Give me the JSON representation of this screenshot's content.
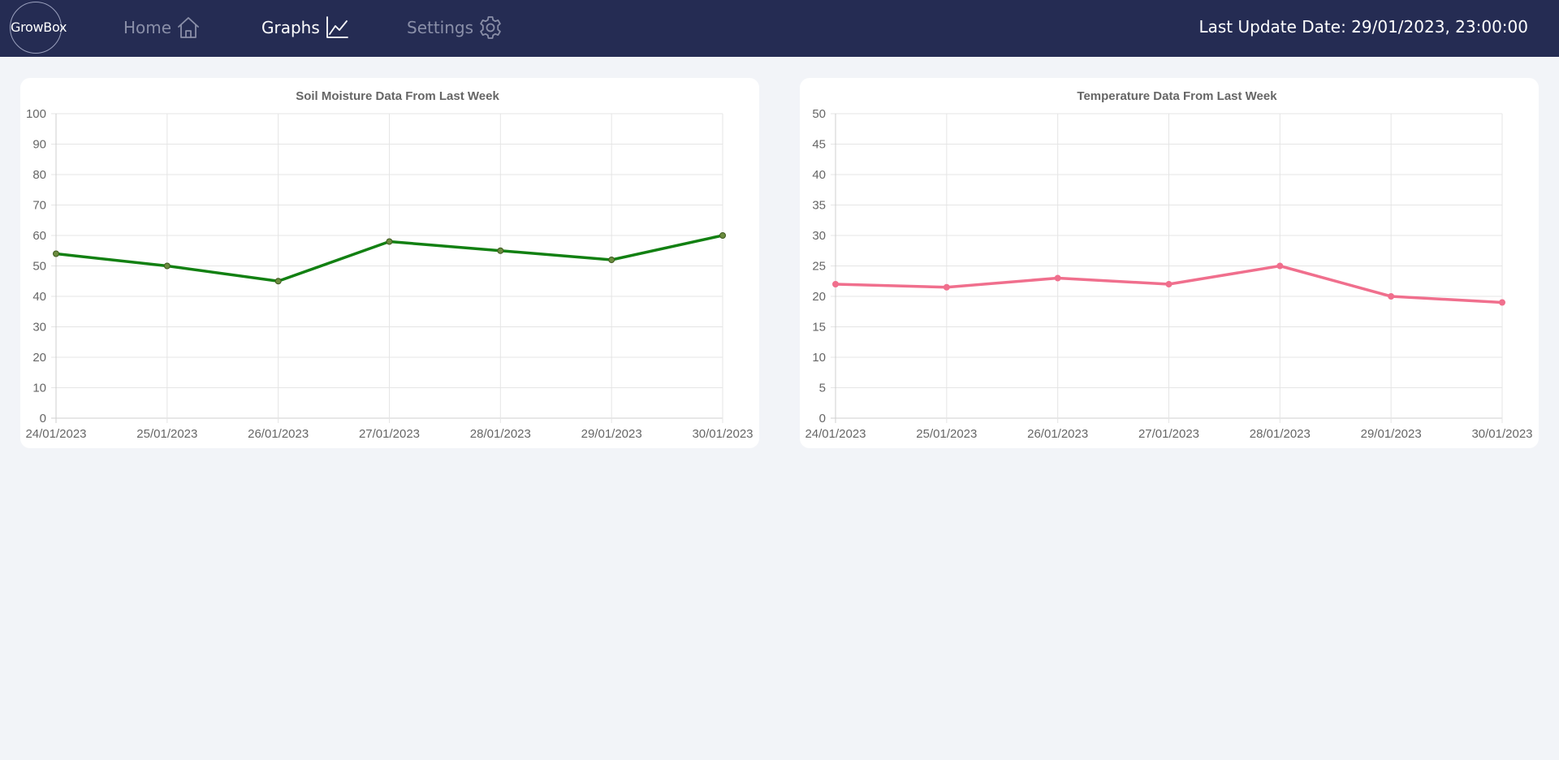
{
  "header": {
    "logo": "GrowBox",
    "nav": [
      {
        "label": "Home",
        "icon": "home-icon",
        "active": false
      },
      {
        "label": "Graphs",
        "icon": "chart-line-icon",
        "active": true
      },
      {
        "label": "Settings",
        "icon": "gear-icon",
        "active": false
      }
    ],
    "last_update": "Last Update Date: 29/01/2023, 23:00:00"
  },
  "colors": {
    "navbar_bg": "#252c53",
    "page_bg": "#f2f4f8",
    "soil_line": "#128012",
    "soil_point": "#6b8c3f",
    "temp_line": "#f06f8d"
  },
  "chart_data": [
    {
      "type": "line",
      "title": "Soil Moisture Data From Last Week",
      "categories": [
        "24/01/2023",
        "25/01/2023",
        "26/01/2023",
        "27/01/2023",
        "28/01/2023",
        "29/01/2023",
        "30/01/2023"
      ],
      "series": [
        {
          "values": [
            54,
            50,
            45,
            58,
            55,
            52,
            60
          ],
          "color": "#128012"
        }
      ],
      "ylim": [
        0,
        100
      ],
      "yticks": [
        0,
        10,
        20,
        30,
        40,
        50,
        60,
        70,
        80,
        90,
        100
      ],
      "xlabel": "",
      "ylabel": "",
      "grid": true,
      "legend": "none"
    },
    {
      "type": "line",
      "title": "Temperature Data From Last Week",
      "categories": [
        "24/01/2023",
        "25/01/2023",
        "26/01/2023",
        "27/01/2023",
        "28/01/2023",
        "29/01/2023",
        "30/01/2023"
      ],
      "series": [
        {
          "values": [
            22,
            21.5,
            23,
            22,
            25,
            20,
            19
          ],
          "color": "#f06f8d"
        }
      ],
      "ylim": [
        0,
        50
      ],
      "yticks": [
        0,
        5,
        10,
        15,
        20,
        25,
        30,
        35,
        40,
        45,
        50
      ],
      "xlabel": "",
      "ylabel": "",
      "grid": true,
      "legend": "none"
    }
  ]
}
